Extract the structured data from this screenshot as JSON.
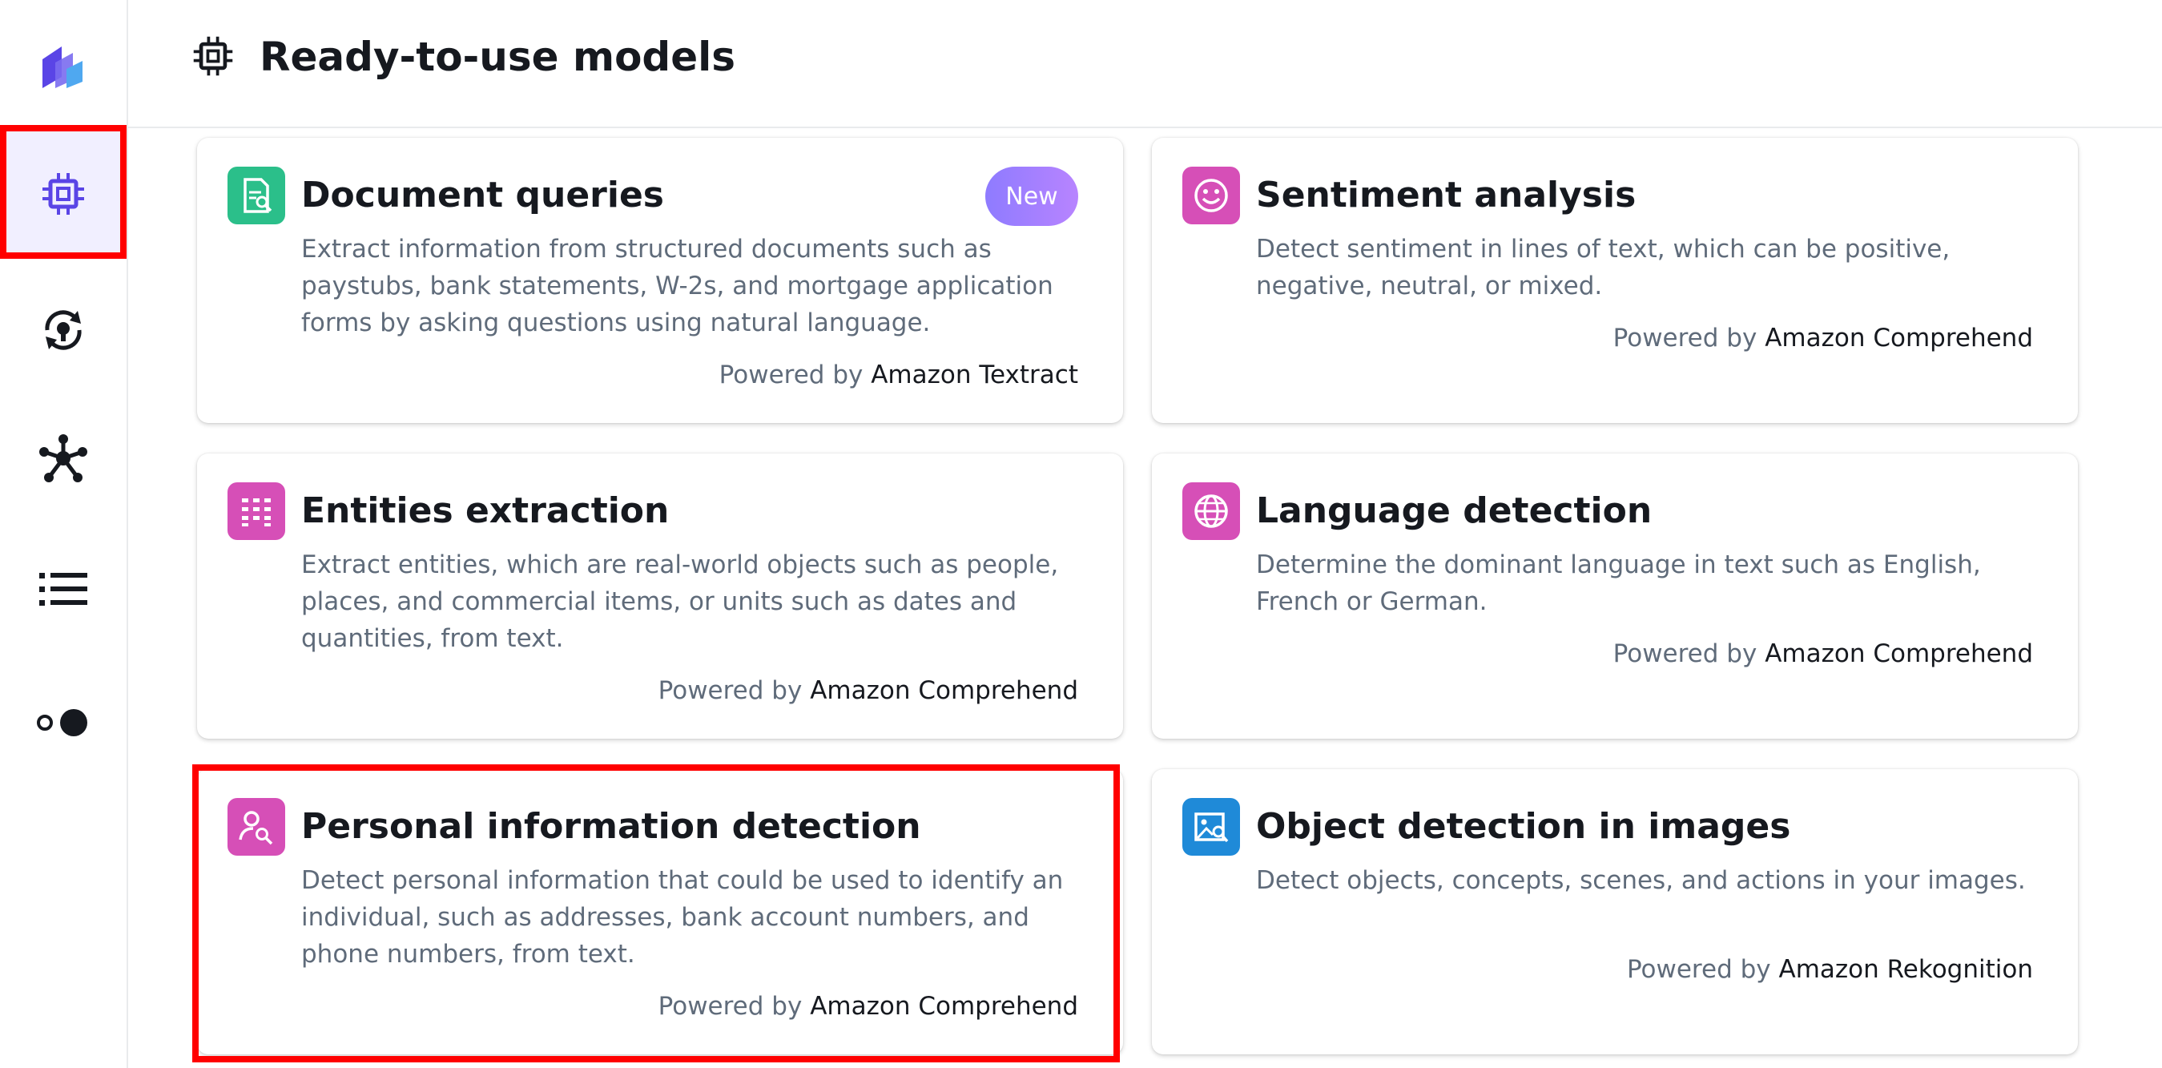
{
  "header": {
    "title": "Ready-to-use models",
    "icon": "chip-icon"
  },
  "sidebar": {
    "items": [
      {
        "name": "logo",
        "icon": "canvas-logo-icon"
      },
      {
        "name": "ready-to-use-models",
        "icon": "chip-icon",
        "active": true
      },
      {
        "name": "my-models",
        "icon": "lightbulb-refresh-icon"
      },
      {
        "name": "ml-ops",
        "icon": "network-nodes-icon"
      },
      {
        "name": "datasets",
        "icon": "list-icon"
      },
      {
        "name": "toggle",
        "icon": "toggle-dots-icon"
      }
    ]
  },
  "colors": {
    "accent": "#5a45e6",
    "highlight": "#ff0000",
    "doc_icon_bg": "#2bbf8a",
    "pink_icon_bg": "#d64fb7",
    "blue_icon_bg": "#1f8ad8",
    "badge": "#9b7cff"
  },
  "cards": [
    {
      "title": "Document queries",
      "badge": "New",
      "icon": "document-search-icon",
      "description": "Extract information from structured documents such as paystubs, bank statements, W-2s, and mortgage application forms by asking questions using natural language.",
      "powered_prefix": "Powered by",
      "service": "Amazon Textract"
    },
    {
      "title": "Sentiment analysis",
      "icon": "smiley-icon",
      "description": "Detect sentiment in lines of text, which can be positive, negative, neutral, or mixed.",
      "powered_prefix": "Powered by",
      "service": "Amazon Comprehend"
    },
    {
      "title": "Entities extraction",
      "icon": "grid-list-icon",
      "description": "Extract entities, which are real-world objects such as people, places, and commercial items, or units such as dates and quantities, from text.",
      "powered_prefix": "Powered by",
      "service": "Amazon Comprehend"
    },
    {
      "title": "Language detection",
      "icon": "globe-icon",
      "description": "Determine the dominant language in text such as English, French or German.",
      "powered_prefix": "Powered by",
      "service": "Amazon Comprehend"
    },
    {
      "title": "Personal information detection",
      "icon": "person-search-icon",
      "description": "Detect personal information that could be used to identify an individual, such as addresses, bank account numbers, and phone numbers, from text.",
      "powered_prefix": "Powered by",
      "service": "Amazon Comprehend"
    },
    {
      "title": "Object detection in images",
      "icon": "image-search-icon",
      "description": "Detect objects, concepts, scenes, and actions in your images.",
      "powered_prefix": "Powered by",
      "service": "Amazon Rekognition"
    }
  ]
}
